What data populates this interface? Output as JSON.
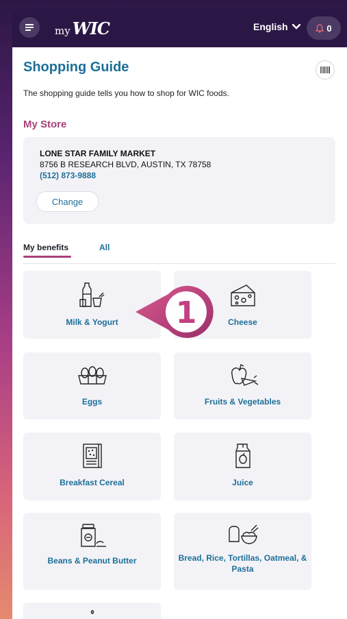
{
  "header": {
    "logo_prefix": "my",
    "logo_main": "WIC",
    "language": "English",
    "notification_count": "0"
  },
  "page": {
    "title": "Shopping Guide",
    "description": "The shopping guide tells you how to shop for WIC foods."
  },
  "store": {
    "section_title": "My Store",
    "name": "LONE STAR FAMILY MARKET",
    "address": "8756 B RESEARCH BLVD, AUSTIN, TX 78758",
    "phone": "(512) 873-9888",
    "change_label": "Change"
  },
  "tabs": {
    "my_benefits": "My benefits",
    "all": "All"
  },
  "categories": [
    {
      "label": "Milk & Yogurt",
      "icon": "milk-yogurt-icon"
    },
    {
      "label": "Cheese",
      "icon": "cheese-icon"
    },
    {
      "label": "Eggs",
      "icon": "eggs-icon"
    },
    {
      "label": "Fruits & Vegetables",
      "icon": "fruits-vegetables-icon"
    },
    {
      "label": "Breakfast Cereal",
      "icon": "cereal-icon"
    },
    {
      "label": "Juice",
      "icon": "juice-icon"
    },
    {
      "label": "Beans & Peanut Butter",
      "icon": "beans-peanut-butter-icon"
    },
    {
      "label": "Bread, Rice, Tortillas, Oatmeal, & Pasta",
      "icon": "bread-rice-icon"
    }
  ],
  "callout": {
    "number": "1",
    "color": "#c2407e"
  }
}
